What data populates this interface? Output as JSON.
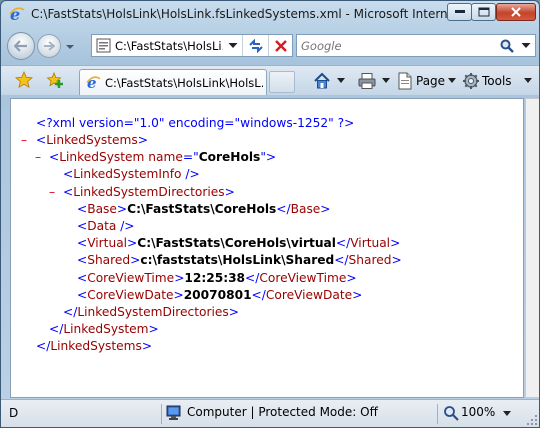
{
  "window": {
    "title": "C:\\FastStats\\HolsLink\\HolsLink.fsLinkedSystems.xml - Microsoft Internet Ex..."
  },
  "address": {
    "text": "C:\\FastStats\\HolsLi..."
  },
  "search": {
    "placeholder": "Google"
  },
  "tab": {
    "label": "C:\\FastStats\\HolsLink\\HolsL..."
  },
  "toolbar": {
    "page_label": "Page",
    "tools_label": "Tools"
  },
  "xml": {
    "declaration": "<?xml version=\"1.0\" encoding=\"windows-1252\" ?>",
    "lines": [
      {
        "toggle": "–",
        "parts": [
          [
            "p",
            "<"
          ],
          [
            "t",
            "LinkedSystems"
          ],
          [
            "p",
            ">"
          ]
        ]
      },
      {
        "toggle": "–",
        "parts": [
          [
            "p",
            "<"
          ],
          [
            "t",
            "LinkedSystem"
          ],
          [
            "a",
            " name"
          ],
          [
            "p",
            "=\""
          ],
          [
            "v",
            "CoreHols"
          ],
          [
            "p",
            "\">"
          ]
        ]
      },
      {
        "toggle": "",
        "parts": [
          [
            "p",
            "<"
          ],
          [
            "t",
            "LinkedSystemInfo"
          ],
          [
            "p",
            " />"
          ]
        ]
      },
      {
        "toggle": "–",
        "parts": [
          [
            "p",
            "<"
          ],
          [
            "t",
            "LinkedSystemDirectories"
          ],
          [
            "p",
            ">"
          ]
        ]
      },
      {
        "toggle": "",
        "parts": [
          [
            "p",
            "<"
          ],
          [
            "t",
            "Base"
          ],
          [
            "p",
            ">"
          ],
          [
            "x",
            "C:\\FastStats\\CoreHols"
          ],
          [
            "p",
            "</"
          ],
          [
            "t",
            "Base"
          ],
          [
            "p",
            ">"
          ]
        ]
      },
      {
        "toggle": "",
        "parts": [
          [
            "p",
            "<"
          ],
          [
            "t",
            "Data"
          ],
          [
            "p",
            " />"
          ]
        ]
      },
      {
        "toggle": "",
        "parts": [
          [
            "p",
            "<"
          ],
          [
            "t",
            "Virtual"
          ],
          [
            "p",
            ">"
          ],
          [
            "x",
            "C:\\FastStats\\CoreHols\\virtual"
          ],
          [
            "p",
            "</"
          ],
          [
            "t",
            "Virtual"
          ],
          [
            "p",
            ">"
          ]
        ]
      },
      {
        "toggle": "",
        "parts": [
          [
            "p",
            "<"
          ],
          [
            "t",
            "Shared"
          ],
          [
            "p",
            ">"
          ],
          [
            "x",
            "c:\\faststats\\HolsLink\\Shared"
          ],
          [
            "p",
            "</"
          ],
          [
            "t",
            "Shared"
          ],
          [
            "p",
            ">"
          ]
        ]
      },
      {
        "toggle": "",
        "parts": [
          [
            "p",
            "<"
          ],
          [
            "t",
            "CoreViewTime"
          ],
          [
            "p",
            ">"
          ],
          [
            "x",
            "12:25:38"
          ],
          [
            "p",
            "</"
          ],
          [
            "t",
            "CoreViewTime"
          ],
          [
            "p",
            ">"
          ]
        ]
      },
      {
        "toggle": "",
        "parts": [
          [
            "p",
            "<"
          ],
          [
            "t",
            "CoreViewDate"
          ],
          [
            "p",
            ">"
          ],
          [
            "x",
            "20070801"
          ],
          [
            "p",
            "</"
          ],
          [
            "t",
            "CoreViewDate"
          ],
          [
            "p",
            ">"
          ]
        ]
      },
      {
        "toggle": "",
        "parts": [
          [
            "p",
            "</"
          ],
          [
            "t",
            "LinkedSystemDirectories"
          ],
          [
            "p",
            ">"
          ]
        ]
      },
      {
        "toggle": "",
        "parts": [
          [
            "p",
            "</"
          ],
          [
            "t",
            "LinkedSystem"
          ],
          [
            "p",
            ">"
          ]
        ]
      },
      {
        "toggle": "",
        "parts": [
          [
            "p",
            "</"
          ],
          [
            "t",
            "LinkedSystems"
          ],
          [
            "p",
            ">"
          ]
        ]
      }
    ]
  },
  "status": {
    "left": "D",
    "zone": "Computer | Protected Mode: Off",
    "zoom": "100%"
  },
  "colors": {
    "xml_markup": "#0000ff",
    "xml_tag": "#990000",
    "xml_toggle": "#e0001a"
  }
}
